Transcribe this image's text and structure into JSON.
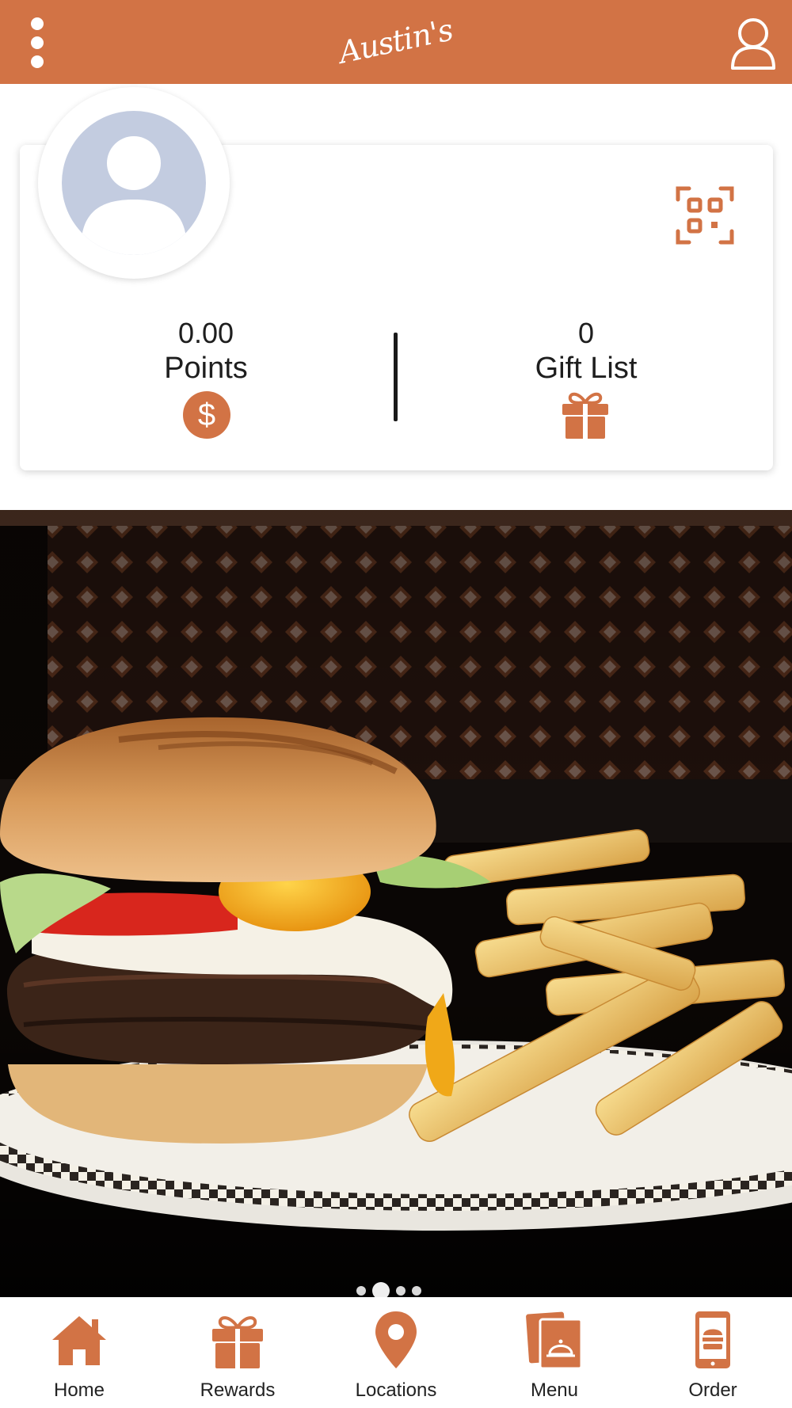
{
  "header": {
    "brand": "Austin's",
    "menu_icon": "more-vertical-icon",
    "profile_icon": "user-outline-icon",
    "color": "#d27345"
  },
  "card": {
    "points_value": "0.00",
    "points_label": "Points",
    "points_icon": "dollar-circle-icon",
    "gifts_value": "0",
    "gifts_label": "Gift List",
    "gifts_icon": "gift-icon",
    "qr_icon": "qr-scan-icon",
    "avatar_icon": "default-avatar-icon"
  },
  "hero": {
    "image": "burger with fried egg and fries on checkered plate",
    "pager_count": 4,
    "pager_active": 2
  },
  "nav": {
    "items": [
      {
        "label": "Home",
        "icon": "home-icon"
      },
      {
        "label": "Rewards",
        "icon": "gift-icon"
      },
      {
        "label": "Locations",
        "icon": "map-pin-icon"
      },
      {
        "label": "Menu",
        "icon": "menu-cloche-icon"
      },
      {
        "label": "Order",
        "icon": "mobile-order-icon"
      }
    ]
  }
}
